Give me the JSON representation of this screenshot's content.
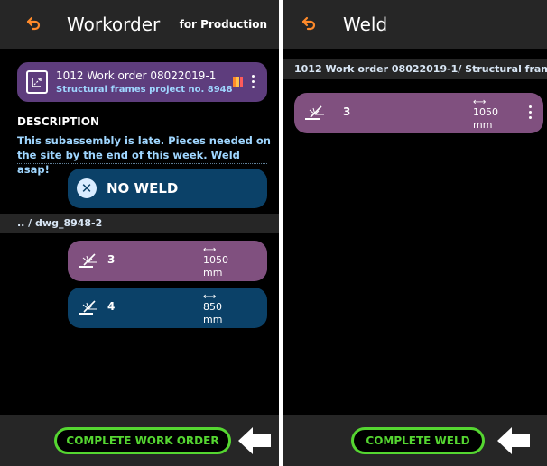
{
  "left_screen": {
    "header": {
      "title": "Workorder",
      "subtitle": "for Production"
    },
    "work_order": {
      "title": "1012 Work order 08022019-1",
      "project": "Structural frames project no. 8948"
    },
    "description": {
      "label": "DESCRIPTION",
      "text": "This subassembly is late. Pieces needed on the site by the end of this week. Weld asap!"
    },
    "no_weld_label": "NO WELD",
    "path": ".. / dwg_8948-2",
    "pieces": [
      {
        "qty": "3",
        "length": "1050",
        "unit": "mm",
        "color": "#80507f"
      },
      {
        "qty": "4",
        "length": "850",
        "unit": "mm",
        "color": "#0b4168"
      }
    ],
    "cta_label": "COMPLETE WORK ORDER"
  },
  "right_screen": {
    "header": {
      "title": "Weld"
    },
    "path": "1012 Work order 08022019-1/ Structural frame...",
    "pieces": [
      {
        "qty": "3",
        "length": "1050",
        "unit": "mm",
        "color": "#80507f"
      }
    ],
    "cta_label": "COMPLETE WELD"
  },
  "colors": {
    "accent_orange": "#ff8a2a",
    "cta_green": "#55d631",
    "text_blue": "#9fd6ff",
    "purple_card": "#5e3d7d"
  },
  "icons": {
    "back": "undo-arrow-icon",
    "work_order": "document-icon",
    "no_weld": "x-circle-icon",
    "weld": "welding-torch-icon",
    "length": "double-arrow-icon",
    "hint": "pointer-arrow-icon"
  }
}
